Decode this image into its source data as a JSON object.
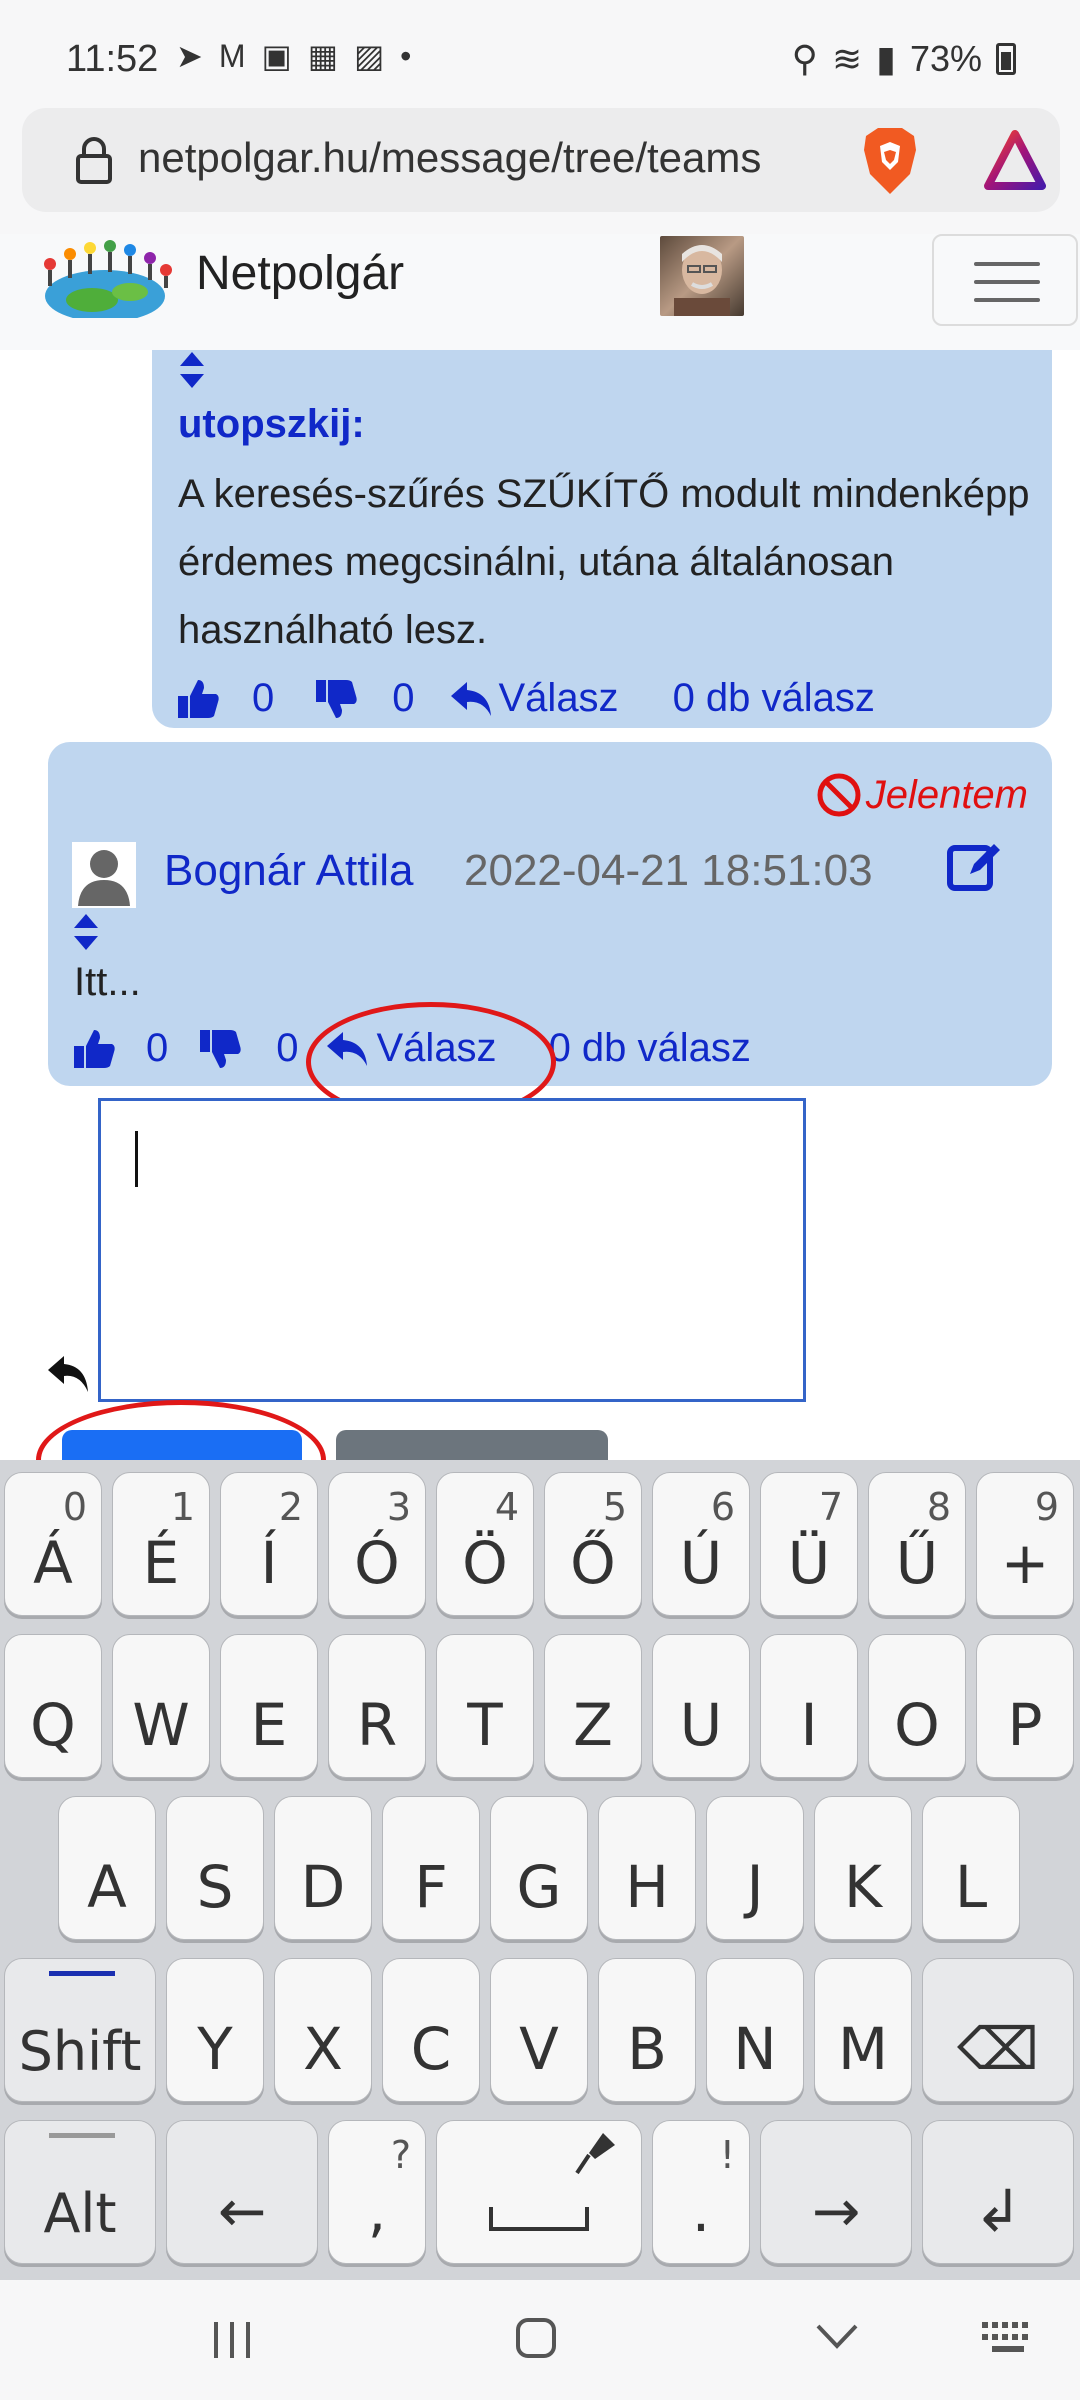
{
  "status_bar": {
    "time": "11:52",
    "battery": "73%"
  },
  "browser": {
    "url": "netpolgar.hu/message/tree/teams"
  },
  "site": {
    "brand": "Netpolgár"
  },
  "post1": {
    "author": "utopszkij:",
    "text": "A keresés-szűrés SZŰKÍTŐ modult mindenképp érdemes megcsinálni, utána általánosan használható lesz.",
    "likes": "0",
    "dislikes": "0",
    "reply_label": "Válasz",
    "replies_count": "0 db válasz"
  },
  "post2": {
    "report_label": "Jelentem",
    "author": "Bognár Attila",
    "date": "2022-04-21 18:51:03",
    "text": "Itt...",
    "likes": "0",
    "dislikes": "0",
    "reply_label": "Válasz",
    "replies_count": "0 db válasz"
  },
  "keyboard": {
    "row1": [
      {
        "label": "Á",
        "hint": "0"
      },
      {
        "label": "É",
        "hint": "1"
      },
      {
        "label": "Í",
        "hint": "2"
      },
      {
        "label": "Ó",
        "hint": "3"
      },
      {
        "label": "Ö",
        "hint": "4"
      },
      {
        "label": "Ő",
        "hint": "5"
      },
      {
        "label": "Ú",
        "hint": "6"
      },
      {
        "label": "Ü",
        "hint": "7"
      },
      {
        "label": "Ű",
        "hint": "8"
      },
      {
        "label": "+",
        "hint": "9"
      }
    ],
    "row2": [
      "Q",
      "W",
      "E",
      "R",
      "T",
      "Z",
      "U",
      "I",
      "O",
      "P"
    ],
    "row3": [
      "A",
      "S",
      "D",
      "F",
      "G",
      "H",
      "J",
      "K",
      "L"
    ],
    "row4": [
      "Y",
      "X",
      "C",
      "V",
      "B",
      "N",
      "M"
    ],
    "shift_label": "Shift",
    "alt_label": "Alt",
    "left_arrow": "←",
    "right_arrow": "→",
    "comma": ",",
    "comma_hint": "?",
    "period": ".",
    "period_hint": "!",
    "enter": "↲",
    "backspace": "⌫"
  },
  "colors": {
    "card": "#bfd6ef",
    "link": "#1028c8",
    "report": "#e01010",
    "annotation": "#e01818"
  }
}
